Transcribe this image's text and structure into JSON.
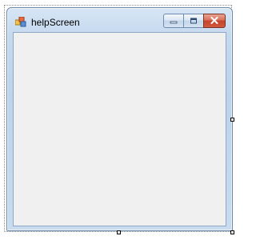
{
  "window": {
    "title": "helpScreen",
    "icon": "form-icon"
  },
  "caption_buttons": {
    "minimize_icon": "minimize-icon",
    "maximize_icon": "maximize-icon",
    "close_icon": "close-icon"
  },
  "colors": {
    "frame": "#c5d9ee",
    "client_background": "#f0f0f0",
    "close_button": "#c4432b"
  }
}
